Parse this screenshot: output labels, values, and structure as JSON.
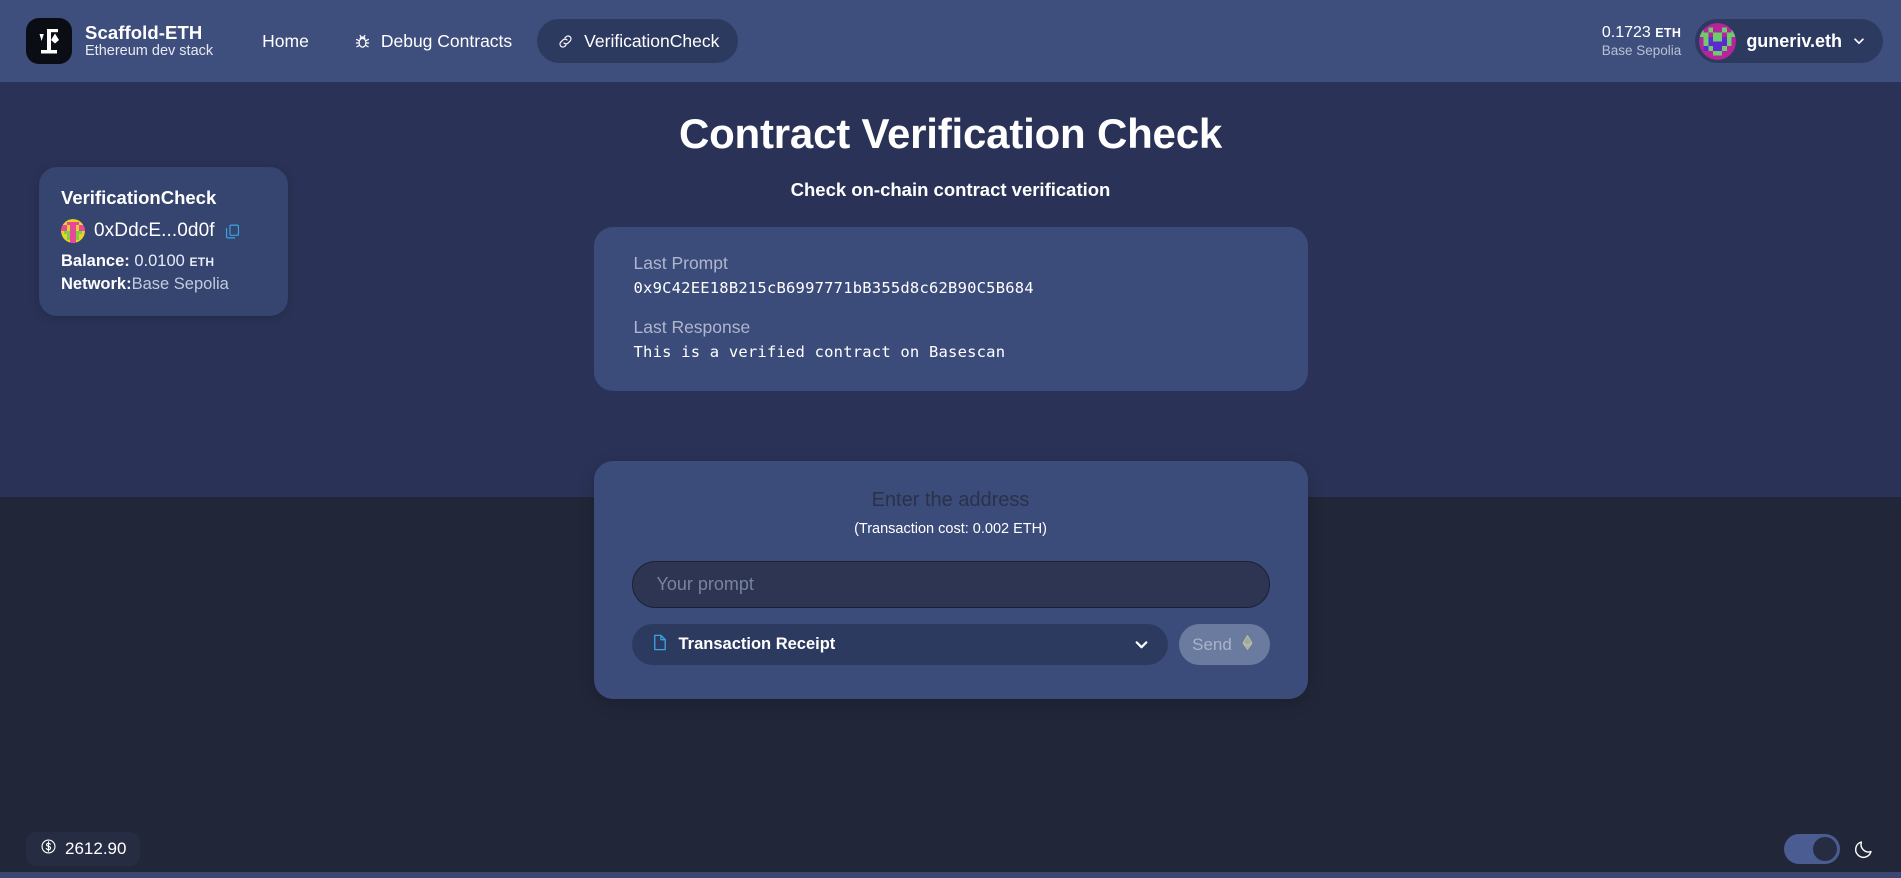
{
  "header": {
    "brand": {
      "title": "Scaffold-ETH",
      "subtitle": "Ethereum dev stack",
      "logo_icon": "scaffold-eth-logo-icon"
    },
    "nav": [
      {
        "label": "Home",
        "icon": "",
        "active": false
      },
      {
        "label": "Debug Contracts",
        "icon": "bug-icon",
        "active": false
      },
      {
        "label": "VerificationCheck",
        "icon": "link-icon",
        "active": true
      }
    ],
    "balance": {
      "amount": "0.1723",
      "unit": "ETH",
      "network": "Base Sepolia"
    },
    "account": {
      "name": "guneriv.eth",
      "avatar_icon": "blockie-avatar",
      "chevron_icon": "chevron-down-icon"
    }
  },
  "sidebar": {
    "contract_card": {
      "title": "VerificationCheck",
      "address": "0xDdcE...0d0f",
      "address_avatar_icon": "blockie-avatar-small",
      "copy_icon": "copy-icon",
      "balance_label": "Balance:",
      "balance_value": "0.0100",
      "balance_unit": "ETH",
      "network_label": "Network:",
      "network_value": "Base Sepolia"
    }
  },
  "main": {
    "title": "Contract Verification Check",
    "subtitle": "Check on-chain contract verification",
    "status": {
      "prompt_label": "Last Prompt",
      "prompt_value": "0x9C42EE18B215cB6997771bB355d8c62B90C5B684",
      "response_label": "Last Response",
      "response_value": "This is a verified contract on Basescan"
    },
    "form": {
      "title": "Enter the address",
      "cost": "(Transaction cost: 0.002 ETH)",
      "input_value": "",
      "input_placeholder": "Your prompt",
      "select_label": "Transaction Receipt",
      "select_icon": "document-icon",
      "select_chevron_icon": "chevron-down-icon",
      "send_label": "Send",
      "send_icon": "ethereum-diamond-icon"
    }
  },
  "footer": {
    "price": "2612.90",
    "price_icon": "dollar-circle-icon",
    "theme_toggle_icon": "toggle-switch",
    "theme_icon": "moon-icon"
  },
  "colors": {
    "header_bg": "#3f4f7d",
    "top_section_bg": "#2a3357",
    "bottom_section_bg": "#212739",
    "card_bg": "#3c4c7a",
    "pill_bg": "#2d3a60",
    "accent": "#4a5c91"
  }
}
